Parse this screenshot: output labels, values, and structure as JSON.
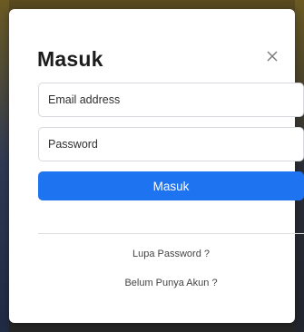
{
  "modal": {
    "title": "Masuk",
    "close_icon": "close-icon",
    "email": {
      "placeholder": "Email address",
      "value": ""
    },
    "password": {
      "placeholder": "Password",
      "value": ""
    },
    "submit_label": "Masuk",
    "forgot_password_link": "Lupa Password ?",
    "register_link": "Belum Punya Akun ?"
  },
  "colors": {
    "primary_button": "#1e73f0",
    "title_text": "#1c1c1c",
    "link_text": "#444444",
    "divider": "#dedede"
  }
}
